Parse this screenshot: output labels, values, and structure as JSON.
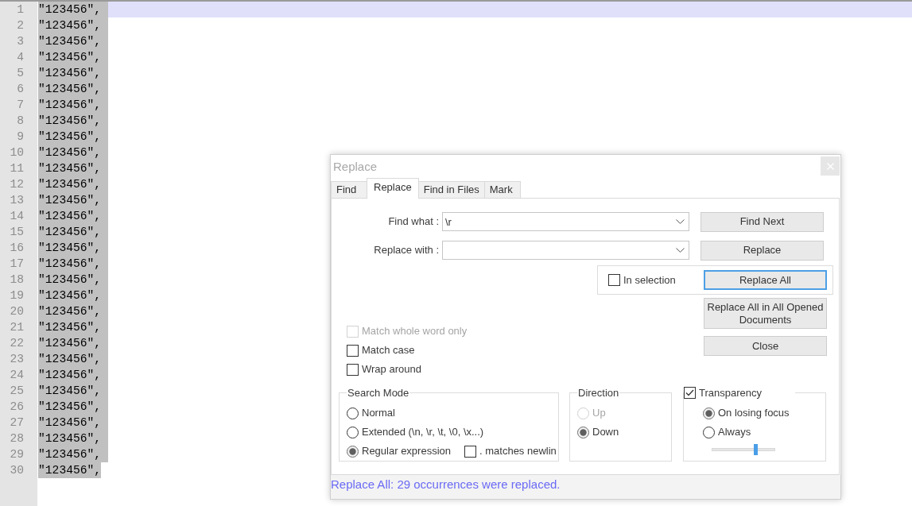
{
  "editor": {
    "lines": [
      {
        "number": "1",
        "text": "\"123456\",",
        "selected": true,
        "current": true
      },
      {
        "number": "2",
        "text": "\"123456\",",
        "selected": true,
        "current": false
      },
      {
        "number": "3",
        "text": "\"123456\",",
        "selected": true,
        "current": false
      },
      {
        "number": "4",
        "text": "\"123456\",",
        "selected": true,
        "current": false
      },
      {
        "number": "5",
        "text": "\"123456\",",
        "selected": true,
        "current": false
      },
      {
        "number": "6",
        "text": "\"123456\",",
        "selected": true,
        "current": false
      },
      {
        "number": "7",
        "text": "\"123456\",",
        "selected": true,
        "current": false
      },
      {
        "number": "8",
        "text": "\"123456\",",
        "selected": true,
        "current": false
      },
      {
        "number": "9",
        "text": "\"123456\",",
        "selected": true,
        "current": false
      },
      {
        "number": "10",
        "text": "\"123456\",",
        "selected": true,
        "current": false
      },
      {
        "number": "11",
        "text": "\"123456\",",
        "selected": true,
        "current": false
      },
      {
        "number": "12",
        "text": "\"123456\",",
        "selected": true,
        "current": false
      },
      {
        "number": "13",
        "text": "\"123456\",",
        "selected": true,
        "current": false
      },
      {
        "number": "14",
        "text": "\"123456\",",
        "selected": true,
        "current": false
      },
      {
        "number": "15",
        "text": "\"123456\",",
        "selected": true,
        "current": false
      },
      {
        "number": "16",
        "text": "\"123456\",",
        "selected": true,
        "current": false
      },
      {
        "number": "17",
        "text": "\"123456\",",
        "selected": true,
        "current": false
      },
      {
        "number": "18",
        "text": "\"123456\",",
        "selected": true,
        "current": false
      },
      {
        "number": "19",
        "text": "\"123456\",",
        "selected": true,
        "current": false
      },
      {
        "number": "20",
        "text": "\"123456\",",
        "selected": true,
        "current": false
      },
      {
        "number": "21",
        "text": "\"123456\",",
        "selected": true,
        "current": false
      },
      {
        "number": "22",
        "text": "\"123456\",",
        "selected": true,
        "current": false
      },
      {
        "number": "23",
        "text": "\"123456\",",
        "selected": true,
        "current": false
      },
      {
        "number": "24",
        "text": "\"123456\",",
        "selected": true,
        "current": false
      },
      {
        "number": "25",
        "text": "\"123456\",",
        "selected": true,
        "current": false
      },
      {
        "number": "26",
        "text": "\"123456\",",
        "selected": true,
        "current": false
      },
      {
        "number": "27",
        "text": "\"123456\",",
        "selected": true,
        "current": false
      },
      {
        "number": "28",
        "text": "\"123456\",",
        "selected": true,
        "current": false
      },
      {
        "number": "29",
        "text": "\"123456\",",
        "selected": true,
        "current": false
      },
      {
        "number": "30",
        "text": "\"123456\",",
        "selected": true,
        "current": false
      }
    ]
  },
  "dialog": {
    "title": "Replace",
    "tabs": [
      {
        "label": "Find",
        "selected": false
      },
      {
        "label": "Replace",
        "selected": true
      },
      {
        "label": "Find in Files",
        "selected": false
      },
      {
        "label": "Mark",
        "selected": false
      }
    ],
    "fields": [
      {
        "label": "Find what :",
        "value": "\\r"
      },
      {
        "label": "Replace with :"
      }
    ],
    "buttons": [
      {
        "label": "Find Next",
        "focused": false
      },
      {
        "label": "Replace",
        "focused": false
      },
      {
        "label": "Replace All",
        "focused": true
      },
      {
        "label": "Replace All in All Opened Documents",
        "focused": false
      },
      {
        "label": "Close",
        "focused": false
      }
    ],
    "in_selection": {
      "label": "In selection",
      "checked": false
    },
    "options": [
      {
        "label": "Match whole word only",
        "checked": false,
        "disabled": true
      },
      {
        "label": "Match case",
        "checked": false,
        "disabled": false
      },
      {
        "label": "Wrap around",
        "checked": false,
        "disabled": false
      }
    ],
    "search_mode": {
      "title": "Search Mode",
      "modes": [
        {
          "label": "Normal",
          "selected": false
        },
        {
          "label": "Extended (\\n, \\r, \\t, \\0, \\x...)",
          "selected": false
        },
        {
          "label": "Regular expression",
          "selected": true
        }
      ],
      "dot_matches_newline": {
        "label": ". matches newlin",
        "checked": false
      }
    },
    "direction": {
      "title": "Direction",
      "options": [
        {
          "label": "Up",
          "selected": false,
          "disabled": true
        },
        {
          "label": "Down",
          "selected": true,
          "disabled": false
        }
      ]
    },
    "transparency": {
      "label": "Transparency",
      "checked": true,
      "options": [
        {
          "label": "On losing focus",
          "selected": true
        },
        {
          "label": "Always",
          "selected": false
        }
      ],
      "slider": {
        "level": 0.69
      }
    },
    "status": "Replace All: 29 occurrences were replaced."
  }
}
